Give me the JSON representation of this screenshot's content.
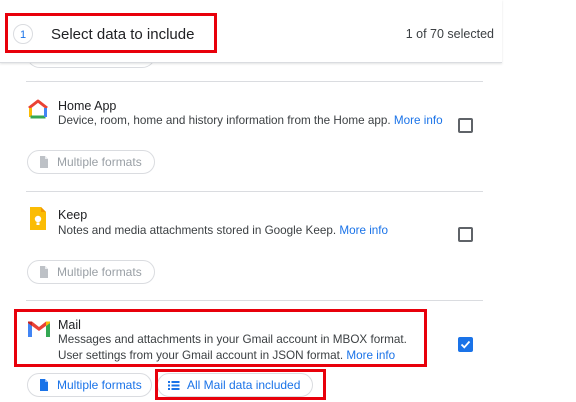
{
  "header": {
    "step_number": "1",
    "title": "Select data to include",
    "selected_count": "1 of 70 selected"
  },
  "items": [
    {
      "title": "Home App",
      "description": "Device, room, home and history information from the Home app.",
      "more_info": "More info",
      "checked": false,
      "formats_label": "Multiple formats",
      "icon": "home-app-icon"
    },
    {
      "title": "Keep",
      "description": "Notes and media attachments stored in Google Keep.",
      "more_info": "More info",
      "checked": false,
      "formats_label": "Multiple formats",
      "icon": "keep-icon"
    },
    {
      "title": "Mail",
      "description": "Messages and attachments in your Gmail account in MBOX format. User settings from your Gmail account in JSON format.",
      "more_info": "More info",
      "checked": true,
      "formats_label": "Multiple formats",
      "data_included_label": "All Mail data included",
      "icon": "gmail-icon"
    }
  ],
  "colors": {
    "accent": "#1a73e8",
    "highlight": "#e8000b",
    "disabled_text": "#9aa0a6"
  }
}
